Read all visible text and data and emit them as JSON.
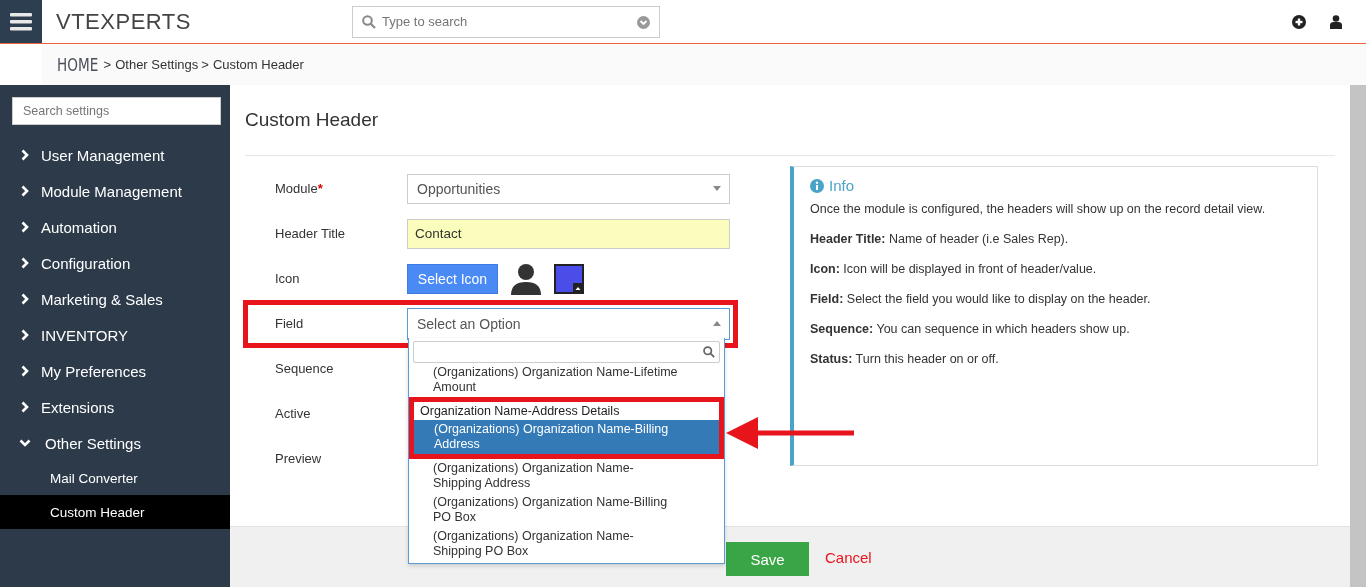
{
  "topbar": {
    "logo": "VTEXPERTS",
    "search": {
      "placeholder": "Type to search"
    }
  },
  "breadcrumb": [
    {
      "label": "HOME",
      "kind": "home",
      "suffix": ">"
    },
    {
      "label": "Other Settings",
      "kind": "link",
      "suffix": ">"
    },
    {
      "label": "Custom Header",
      "kind": "current"
    }
  ],
  "sidebar": {
    "search": {
      "placeholder": "Search settings"
    },
    "items": [
      {
        "label": "User Management",
        "expanded": false
      },
      {
        "label": "Module Management",
        "expanded": false
      },
      {
        "label": "Automation",
        "expanded": false
      },
      {
        "label": "Configuration",
        "expanded": false
      },
      {
        "label": "Marketing & Sales",
        "expanded": false
      },
      {
        "label": "INVENTORY",
        "expanded": false
      },
      {
        "label": "My Preferences",
        "expanded": false
      },
      {
        "label": "Extensions",
        "expanded": false
      },
      {
        "label": "Other Settings",
        "expanded": true,
        "children": [
          {
            "label": "Mail Converter",
            "selected": false
          },
          {
            "label": "Custom Header",
            "selected": true
          }
        ]
      }
    ]
  },
  "page_title": "Custom Header",
  "form": [
    {
      "label": "Module",
      "required_mark": "*",
      "kind": "select",
      "value": "Opportunities"
    },
    {
      "label": "Header Title",
      "kind": "text",
      "value": "Contact"
    },
    {
      "label": "Icon",
      "kind": "icon",
      "button": "Select Icon"
    },
    {
      "label": "Field",
      "kind": "open-select",
      "placeholder": "Select an Option"
    },
    {
      "label": "Sequence",
      "kind": "hidden"
    },
    {
      "label": "Active",
      "kind": "hidden"
    },
    {
      "label": "Preview",
      "kind": "hidden"
    }
  ],
  "dropdown": {
    "options": [
      {
        "label": "(Organizations) Organization Name-Lifetime Amount",
        "kind": "option",
        "selected": false
      },
      {
        "label": "Organization Name-Address Details",
        "kind": "group"
      },
      {
        "label": "(Organizations) Organization Name-Billing Address",
        "kind": "option",
        "selected": true
      },
      {
        "label": "(Organizations) Organization Name-Shipping Address",
        "kind": "option",
        "selected": false
      },
      {
        "label": "(Organizations) Organization Name-Billing PO Box",
        "kind": "option",
        "selected": false
      },
      {
        "label": "(Organizations) Organization Name-Shipping PO Box",
        "kind": "option",
        "selected": false
      }
    ]
  },
  "info": {
    "title": "Info",
    "paragraphs": [
      "Once the module is configured, the headers will show up on the record detail view.",
      "**Header Title:** Name of header (i.e Sales Rep).",
      "**Icon:** Icon will be displayed in front of header/value.",
      "**Field:** Select the field you would like to display on the header.",
      "**Sequence:** You can sequence in which headers show up.",
      "**Status:** Turn this header on or off."
    ]
  },
  "buttons": {
    "save": "Save",
    "cancel": "Cancel"
  }
}
